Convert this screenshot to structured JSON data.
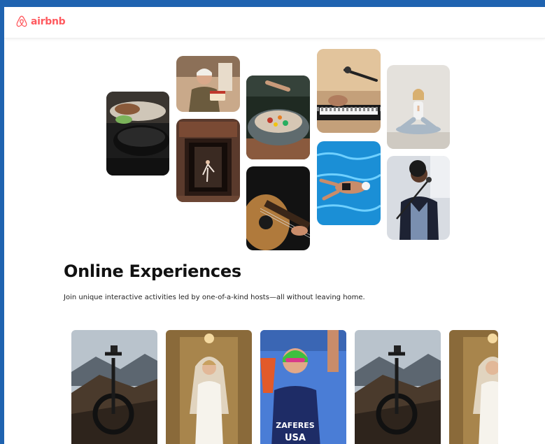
{
  "header": {
    "brand": "airbnb",
    "brand_icon": "airbnb-belo-icon",
    "brand_color": "#ff5a5f"
  },
  "hero": {
    "title": "Online Experiences",
    "subtitle": "Join unique interactive activities led by one-of-a-kind hosts—all without leaving home."
  },
  "collage": [
    {
      "name": "cooking-pan"
    },
    {
      "name": "woman-with-cake"
    },
    {
      "name": "dancer-in-doorway"
    },
    {
      "name": "food-bowl"
    },
    {
      "name": "guitar-player"
    },
    {
      "name": "keyboard-microphone"
    },
    {
      "name": "swimmer-pool"
    },
    {
      "name": "yoga-woman"
    },
    {
      "name": "singer-microphone"
    }
  ],
  "cards": [
    {
      "name": "bicycle-mountain"
    },
    {
      "name": "bride"
    },
    {
      "name": "triathlete"
    },
    {
      "name": "bicycle-mountain"
    },
    {
      "name": "bride"
    }
  ],
  "triathlete_cap_text": "ZAFERES",
  "triathlete_suit_text": "USA",
  "colors": {
    "window_bg": "#ffffff",
    "desktop_bg": "#1f63b0",
    "title": "#111111"
  }
}
